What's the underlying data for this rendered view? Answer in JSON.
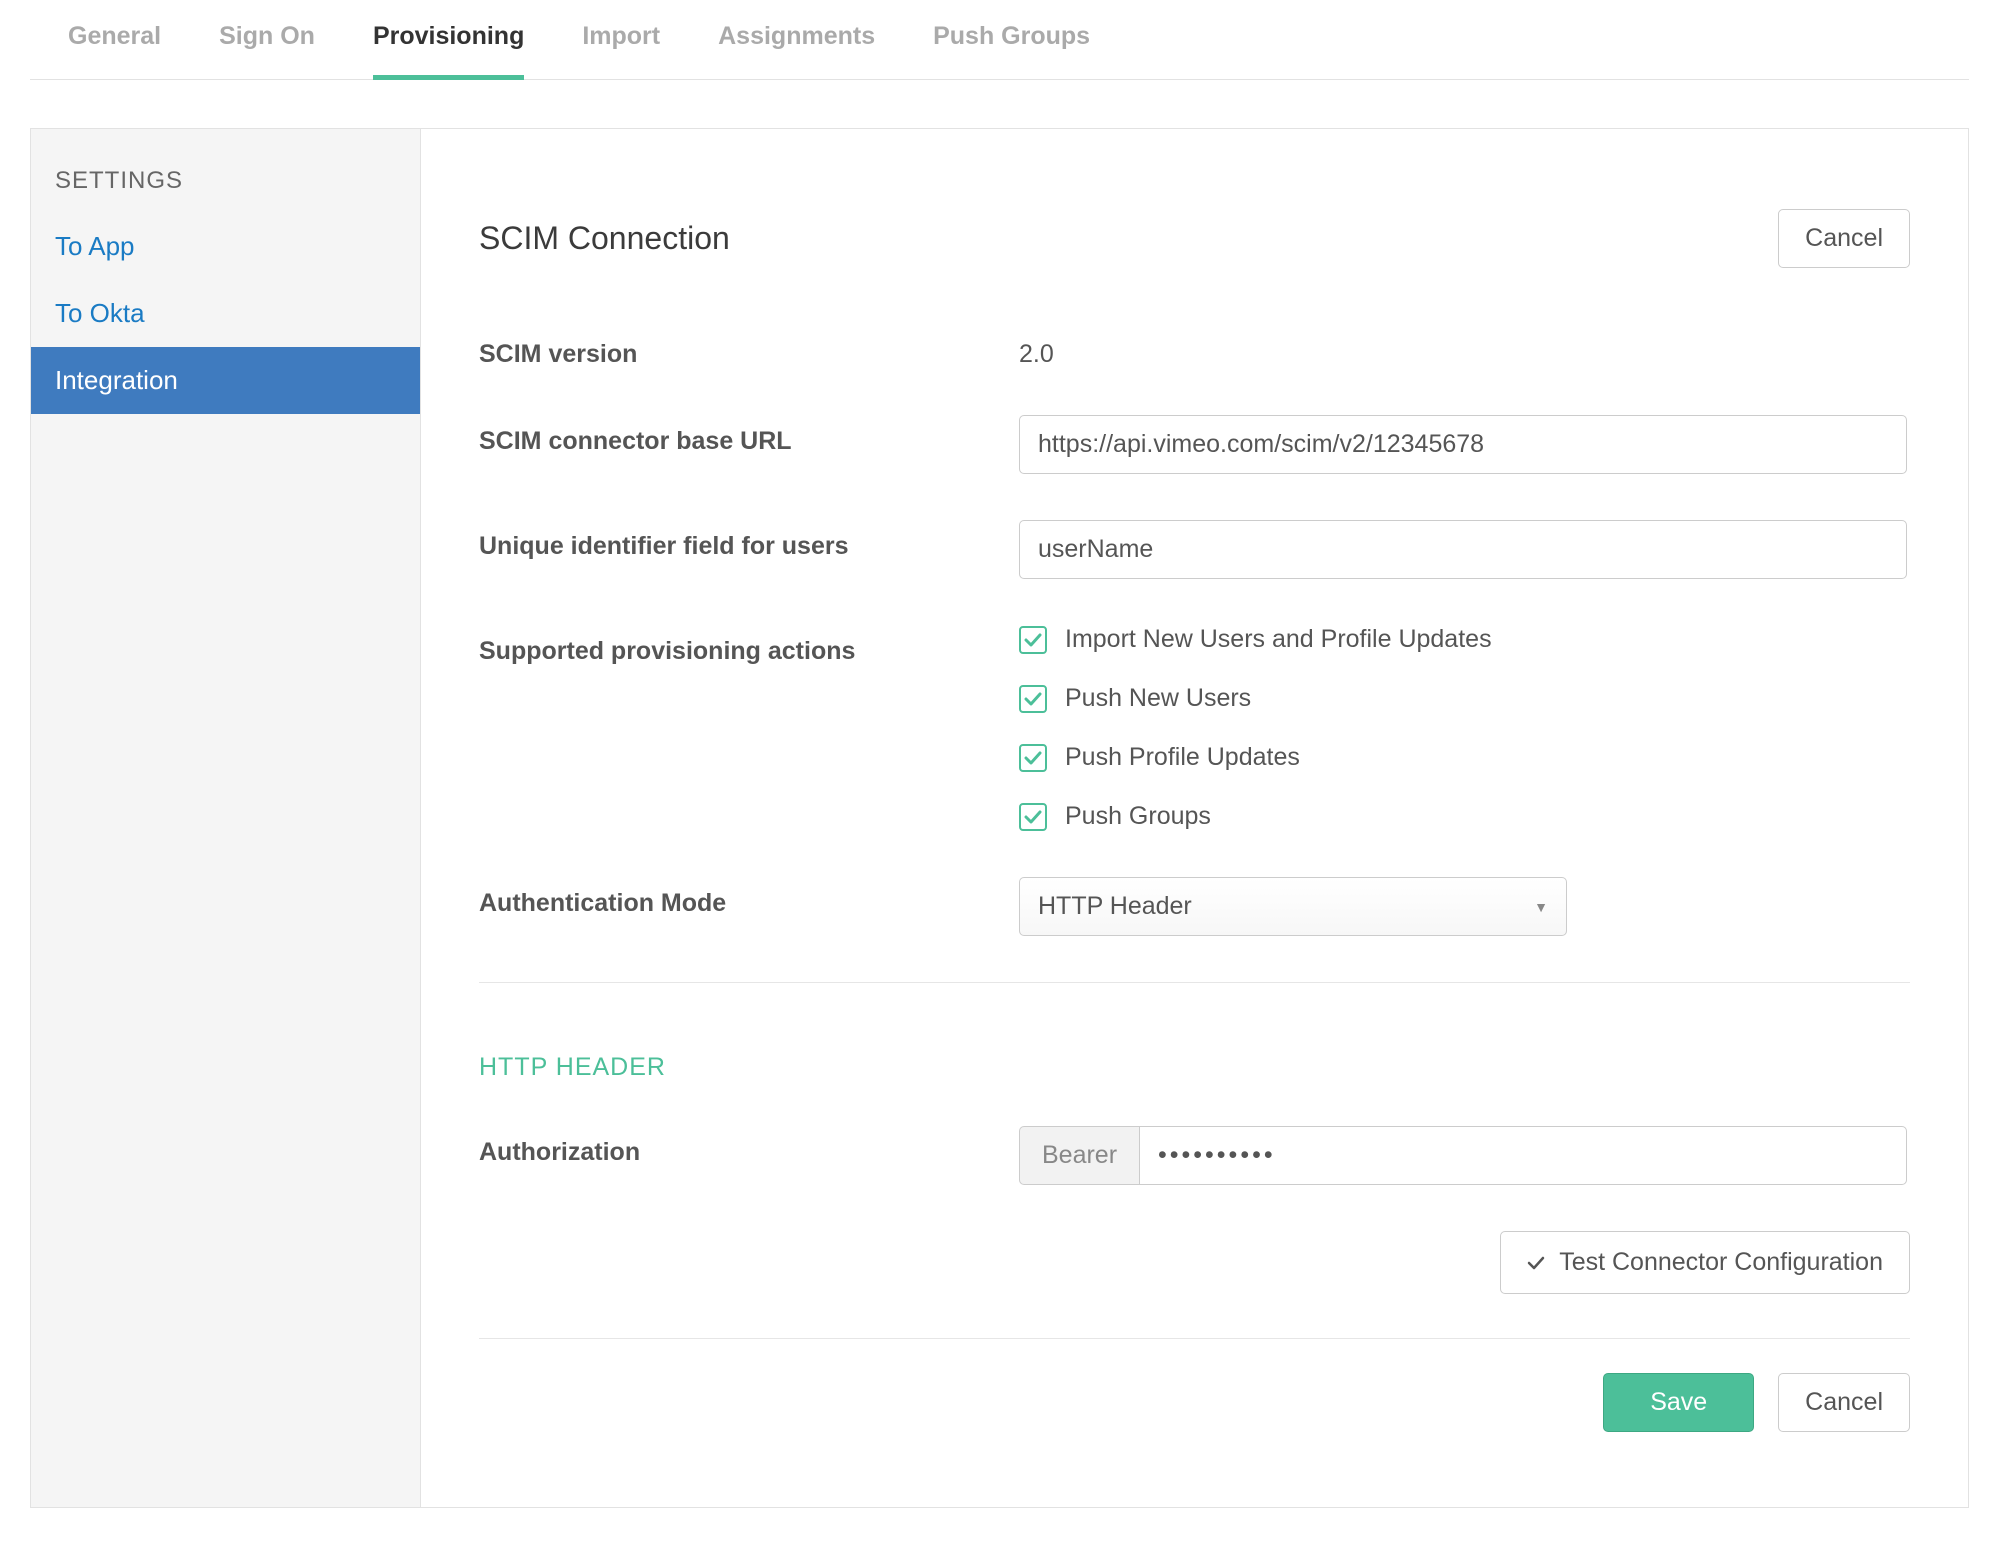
{
  "tabs": [
    {
      "label": "General",
      "active": false
    },
    {
      "label": "Sign On",
      "active": false
    },
    {
      "label": "Provisioning",
      "active": true
    },
    {
      "label": "Import",
      "active": false
    },
    {
      "label": "Assignments",
      "active": false
    },
    {
      "label": "Push Groups",
      "active": false
    }
  ],
  "sidebar": {
    "heading": "SETTINGS",
    "items": [
      {
        "label": "To App",
        "active": false
      },
      {
        "label": "To Okta",
        "active": false
      },
      {
        "label": "Integration",
        "active": true
      }
    ]
  },
  "section": {
    "title": "SCIM Connection",
    "cancel_top": "Cancel",
    "scim_version": {
      "label": "SCIM version",
      "value": "2.0"
    },
    "base_url": {
      "label": "SCIM connector base URL",
      "value": "https://api.vimeo.com/scim/v2/12345678"
    },
    "unique_id": {
      "label": "Unique identifier field for users",
      "value": "userName"
    },
    "actions": {
      "label": "Supported provisioning actions",
      "options": [
        {
          "label": "Import New Users and Profile Updates",
          "checked": true
        },
        {
          "label": "Push New Users",
          "checked": true
        },
        {
          "label": "Push Profile Updates",
          "checked": true
        },
        {
          "label": "Push Groups",
          "checked": true
        }
      ]
    },
    "auth_mode": {
      "label": "Authentication Mode",
      "value": "HTTP Header"
    },
    "http_header": {
      "title": "HTTP HEADER",
      "auth_label": "Authorization",
      "prefix": "Bearer",
      "value": "••••••••••"
    },
    "test_button": "Test Connector Configuration",
    "save_button": "Save",
    "cancel_button": "Cancel"
  }
}
